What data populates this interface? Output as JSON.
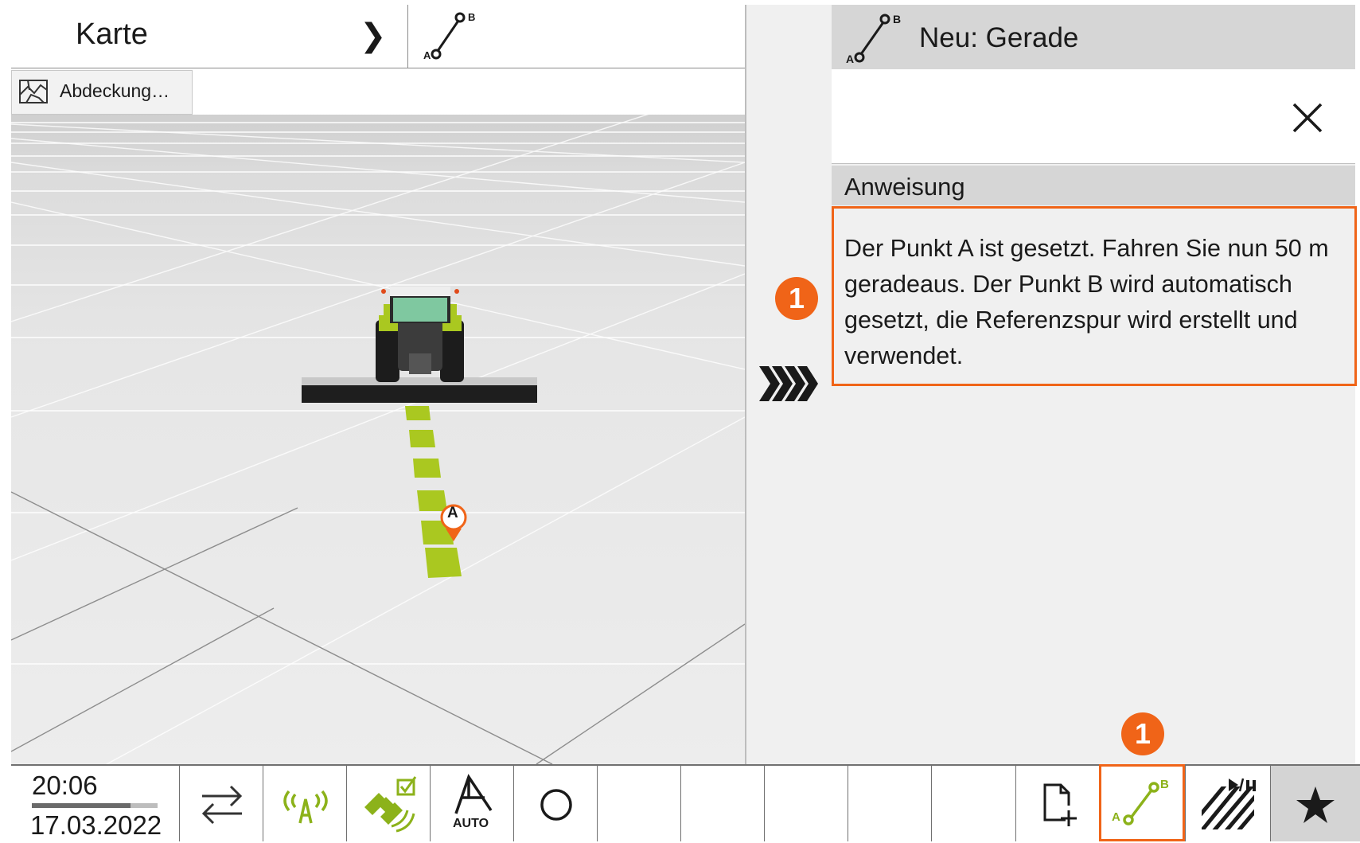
{
  "map": {
    "title": "Karte",
    "coverage_button_label": "Abdeckung…",
    "marker_label": "A"
  },
  "panel": {
    "title": "Neu: Gerade",
    "instruction_heading": "Anweisung",
    "instruction_text": "Der Punkt A ist gesetzt. Fahren Sie nun 50 m geradeaus. Der Punkt B wird automatisch gesetzt, die Referenzspur wird erstellt und verwendet."
  },
  "callouts": {
    "first": "1",
    "second": "1"
  },
  "status": {
    "time": "20:06",
    "date": "17.03.2022"
  },
  "toolbar": {
    "auto_label": "AUTO",
    "ab_point_a": "A",
    "ab_point_b": "B"
  },
  "colors": {
    "accent": "#f06418",
    "lime": "#aac820",
    "panel_bg": "#f0f0f0",
    "header_bg": "#d6d6d6"
  },
  "icons": [
    "chevron-right-icon",
    "ab-line-icon",
    "coverage-map-icon",
    "close-icon",
    "advance-chevrons-icon",
    "switch-arrows-icon",
    "gps-signal-icon",
    "satellite-check-icon",
    "auto-steering-icon",
    "circle-icon",
    "new-document-icon",
    "ab-line-tool-icon",
    "section-control-icon",
    "star-icon"
  ]
}
